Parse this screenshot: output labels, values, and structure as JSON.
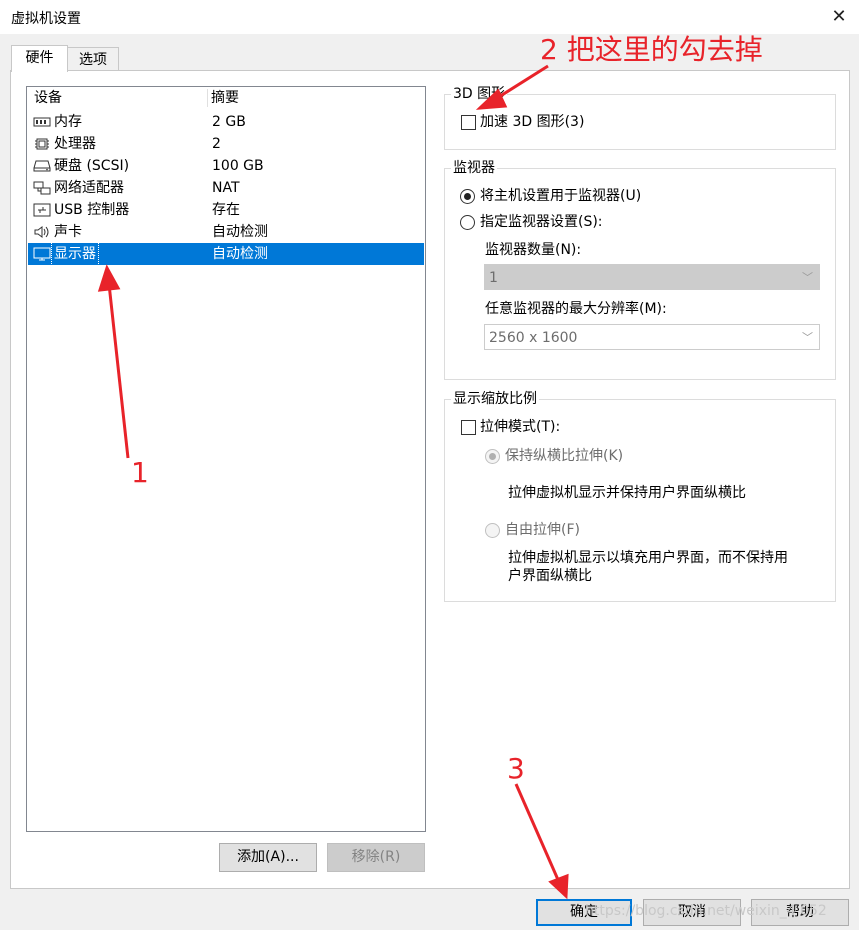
{
  "window": {
    "title": "虚拟机设置",
    "close_glyph": "✕"
  },
  "tabs": [
    {
      "label": "硬件"
    },
    {
      "label": "选项"
    }
  ],
  "device_list": {
    "headers": {
      "device": "设备",
      "summary": "摘要"
    },
    "rows": [
      {
        "name": "内存",
        "summary": "2 GB",
        "icon": "memory-icon"
      },
      {
        "name": "处理器",
        "summary": "2",
        "icon": "processor-icon"
      },
      {
        "name": "硬盘 (SCSI)",
        "summary": "100 GB",
        "icon": "hard-disk-icon"
      },
      {
        "name": "网络适配器",
        "summary": "NAT",
        "icon": "network-adapter-icon"
      },
      {
        "name": "USB 控制器",
        "summary": "存在",
        "icon": "usb-icon"
      },
      {
        "name": "声卡",
        "summary": "自动检测",
        "icon": "speaker-icon"
      },
      {
        "name": "显示器",
        "summary": "自动检测",
        "icon": "monitor-icon",
        "selected": true
      }
    ]
  },
  "list_buttons": {
    "add": "添加(A)...",
    "remove": "移除(R)"
  },
  "graphics_3d": {
    "title": "3D 图形",
    "accelerate_label": "加速 3D 图形(3)",
    "accelerate_checked": false
  },
  "monitors": {
    "title": "监视器",
    "use_host_label": "将主机设置用于监视器(U)",
    "use_host_selected": true,
    "specify_label": "指定监视器设置(S):",
    "count_label": "监视器数量(N):",
    "count_value": "1",
    "max_res_label": "任意监视器的最大分辨率(M):",
    "max_res_value": "2560 x 1600"
  },
  "scaling": {
    "title": "显示缩放比例",
    "stretch_label": "拉伸模式(T):",
    "stretch_checked": false,
    "keep_aspect_label": "保持纵横比拉伸(K)",
    "keep_aspect_desc": "拉伸虚拟机显示并保持用户界面纵横比",
    "free_stretch_label": "自由拉伸(F)",
    "free_stretch_desc_1": "拉伸虚拟机显示以填充用户界面，而不保持用",
    "free_stretch_desc_2": "户界面纵横比"
  },
  "footer_buttons": {
    "ok": "确定",
    "cancel": "取消",
    "help": "帮助"
  },
  "annotations": {
    "step1": "1",
    "step2": "2 把这里的勾去掉",
    "step3": "3",
    "color": "#e8232a"
  },
  "watermark": "https://blog.csdn.net/weixin_4   052"
}
